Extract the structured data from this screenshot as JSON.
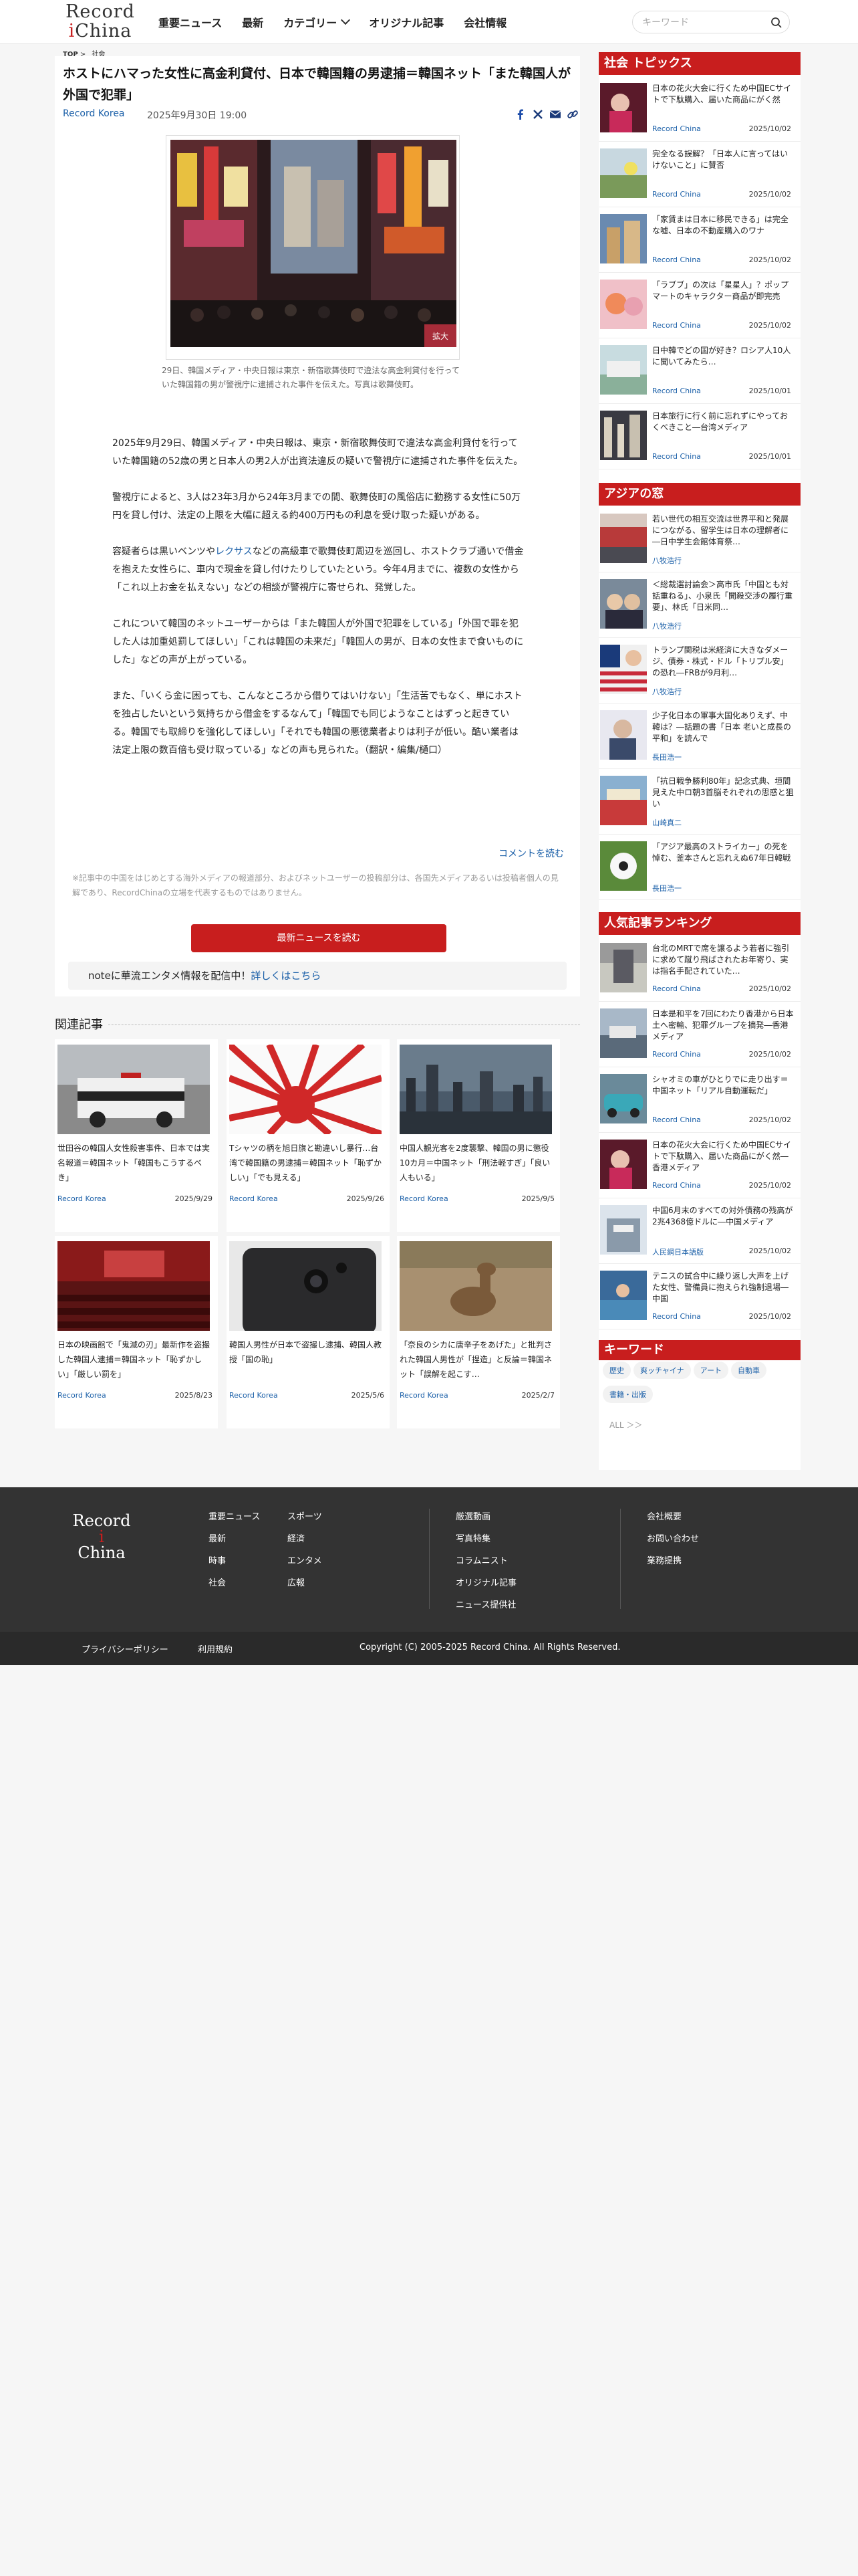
{
  "header": {
    "logo_line1": "Record",
    "logo_line2": "China",
    "nav": [
      "重要ニュース",
      "最新",
      "カテゴリー",
      "オリジナル記事",
      "会社情報"
    ],
    "search_placeholder": "キーワード"
  },
  "breadcrumb": [
    "TOP",
    ">",
    "社会"
  ],
  "article": {
    "title": "ホストにハマった女性に高金利貸付、日本で韓国籍の男逮捕＝韓国ネット「また韓国人が外国で犯罪」",
    "source": "Record Korea",
    "date": "2025年9月30日 19:00",
    "photo_badge": "拡大",
    "caption": "29日、韓国メディア・中央日報は東京・新宿歌舞伎町で違法な高金利貸付を行っていた韓国籍の男が警視庁に逮捕された事件を伝えた。写真は歌舞伎町。",
    "paragraphs": [
      "2025年9月29日、韓国メディア・中央日報は、東京・新宿歌舞伎町で違法な高金利貸付を行っていた韓国籍の52歳の男と日本人の男2人が出資法違反の疑いで警視庁に逮捕された事件を伝えた。",
      "警視庁によると、3人は23年3月から24年3月までの間、歌舞伎町の風俗店に勤務する女性に50万円を貸し付け、法定の上限を大幅に超える約400万円もの利息を受け取った疑いがある。",
      "容疑者らは黒いベンツや",
      "レクサス",
      "などの高級車で歌舞伎町周辺を巡回し、ホストクラブ通いで借金を抱えた女性らに、車内で現金を貸し付けたりしていたという。今年4月までに、複数の女性から「これ以上お金を払えない」などの相談が警視庁に寄せられ、発覚した。",
      "これについて韓国のネットユーザーからは「また韓国人が外国で犯罪をしている」「外国で罪を犯した人は加重処罰してほしい」「これは韓国の未来だ」「韓国人の男が、日本の女性まで食いものにした」などの声が上がっている。",
      "また、「いくら金に困っても、こんなところから借りてはいけない」「生活苦でもなく、単にホストを独占したいという気持ちから借金をするなんて」「韓国でも同じようなことはずっと起きている。韓国でも取締りを強化してほしい」「それでも韓国の悪徳業者よりは利子が低い。酷い業者は法定上限の数百倍も受け取っている」などの声も見られた。（翻訳・編集/樋口）"
    ],
    "comment_link": "コメントを読む",
    "disclaimer": "※記事中の中国をはじめとする海外メディアの報道部分、およびネットユーザーの投稿部分は、各国先メディアあるいは投稿者個人の見解であり、RecordChinaの立場を代表するものではありません。",
    "latest_button": "最新ニュースを読む",
    "note_text": "noteに華流エンタメ情報を配信中！",
    "note_link_text": "詳しくは",
    "note_link": "こちら"
  },
  "related": {
    "title": "関連記事",
    "items": [
      {
        "text": "世田谷の韓国人女性殺害事件、日本では実名報道＝韓国ネット「韓国もこうするべき」",
        "source": "Record Korea",
        "date": "2025/9/29"
      },
      {
        "text": "Tシャツの柄を旭日旗と勘違いし暴行…台湾で韓国籍の男逮捕＝韓国ネット「恥ずかしい」「でも見える」",
        "source": "Record Korea",
        "date": "2025/9/26"
      },
      {
        "text": "中国人観光客を2度襲撃、韓国の男に懲役10カ月＝中国ネット「刑法軽すぎ」「良い人もいる」",
        "source": "Record Korea",
        "date": "2025/9/5"
      },
      {
        "text": "日本の映画館で「鬼滅の刃」最新作を盗撮した韓国人逮捕＝韓国ネット「恥ずかしい」「厳しい罰を」",
        "source": "Record Korea",
        "date": "2025/8/23"
      },
      {
        "text": "韓国人男性が日本で盗撮し逮捕、韓国人教授「国の恥」",
        "source": "Record Korea",
        "date": "2025/5/6"
      },
      {
        "text": "「奈良のシカに唐辛子をあげた」と批判された韓国人男性が「捏造」と反論＝韓国ネット「誤解を起こす…",
        "source": "Record Korea",
        "date": "2025/2/7"
      }
    ]
  },
  "sidebar": {
    "social": {
      "title": "社会 トピックス",
      "items": [
        {
          "text": "日本の花火大会に行くため中国ECサイトで下駄購入、届いた商品にがく然",
          "source": "Record China",
          "date": "2025/10/02"
        },
        {
          "text": "完全なる誤解？「日本人に言ってはいけないこと」に賛否",
          "source": "Record China",
          "date": "2025/10/02"
        },
        {
          "text": "「家賃まは日本に移民できる」は完全な嘘、日本の不動産購入のワナ",
          "source": "Record China",
          "date": "2025/10/02"
        },
        {
          "text": "「ラブブ」の次は「星星人」？ポップマートのキャラクター商品が即完売",
          "source": "Record China",
          "date": "2025/10/02"
        },
        {
          "text": "日中韓でどの国が好き？ロシア人10人に聞いてみたら…",
          "source": "Record China",
          "date": "2025/10/01"
        },
        {
          "text": "日本旅行に行く前に忘れずにやっておくべきこと―台湾メディア",
          "source": "Record China",
          "date": "2025/10/01"
        }
      ]
    },
    "asia": {
      "title": "アジアの窓",
      "items": [
        {
          "text": "若い世代の相互交流は世界平和と発展につながる、留学生は日本の理解者に―日中学生会館体育祭…",
          "source": "八牧浩行",
          "date": ""
        },
        {
          "text": "＜総裁選討論会＞高市氏「中国とも対話重ねる」、小泉氏「開殺交渉の履行重要」、林氏「日米同…",
          "source": "八牧浩行",
          "date": ""
        },
        {
          "text": "トランプ関税は米経済に大きなダメージ、債券・株式・ドル「トリプル安」の恐れ―FRBが9月利…",
          "source": "八牧浩行",
          "date": ""
        },
        {
          "text": "少子化日本の軍事大国化ありえず、中韓は？―話題の書「日本 老いと成長の平和」を読んで",
          "source": "長田浩一",
          "date": ""
        },
        {
          "text": "「抗日戦争勝利80年」記念式典、垣間見えた中ロ朝3首脳それぞれの思惑と狙い",
          "source": "山崎真二",
          "date": ""
        },
        {
          "text": "「アジア最高のストライカー」の死を悼む、釜本さんと忘れえぬ67年日韓戦",
          "source": "長田浩一",
          "date": ""
        }
      ]
    },
    "ranking": {
      "title": "人気記事ランキング",
      "items": [
        {
          "text": "台北のMRTで席を譲るよう若者に強引に求めて蹴り飛ばされたお年寄り、実は指名手配されていた…",
          "source": "Record China",
          "date": "2025/10/02"
        },
        {
          "text": "日本是和平を7回にわたり香港から日本土へ密輸、犯罪グループを摘発―香港メディア",
          "source": "Record China",
          "date": "2025/10/02"
        },
        {
          "text": "シャオミの車がひとりでに走り出す＝中国ネット「リアル自動運転だ」",
          "source": "Record China",
          "date": "2025/10/02"
        },
        {
          "text": "日本の花火大会に行くため中国ECサイトで下駄購入、届いた商品にがく然―香港メディア",
          "source": "Record China",
          "date": "2025/10/02"
        },
        {
          "text": "中国6月末のすべての対外債務の残高が2兆4368億ドルに―中国メディア",
          "source": "人民網日本語版",
          "date": "2025/10/02"
        },
        {
          "text": "テニスの試合中に繰り返し大声を上げた女性、警備員に抱えられ強制退場―中国",
          "source": "Record China",
          "date": "2025/10/02"
        }
      ]
    },
    "keywords": {
      "title": "キーワード",
      "tags": [
        "歴史",
        "爽ッチャイナ",
        "アート",
        "自動車",
        "書籍・出版"
      ],
      "all": "ALL ＞＞"
    }
  },
  "footer": {
    "logo_line1": "Record",
    "logo_line2": "China",
    "col1": [
      "重要ニュース",
      "最新",
      "時事",
      "社会"
    ],
    "col2": [
      "スポーツ",
      "経済",
      "エンタメ",
      "広報"
    ],
    "col3": [
      "厳選動画",
      "写真特集",
      "コラムニスト",
      "オリジナル記事",
      "ニュース提供社"
    ],
    "col4": [
      "会社概要",
      "お問い合わせ",
      "業務提携"
    ],
    "privacy": "プライバシーポリシー",
    "terms": "利用規約",
    "copyright": "Copyright (C) 2005-2025 Record China. All Rights Reserved."
  },
  "colors": {
    "accent": "#c81e1e",
    "link": "#1a5fa8",
    "footer": "#333333"
  },
  "icons": [
    "search-icon",
    "facebook-icon",
    "x-icon",
    "mail-icon",
    "link-icon"
  ]
}
